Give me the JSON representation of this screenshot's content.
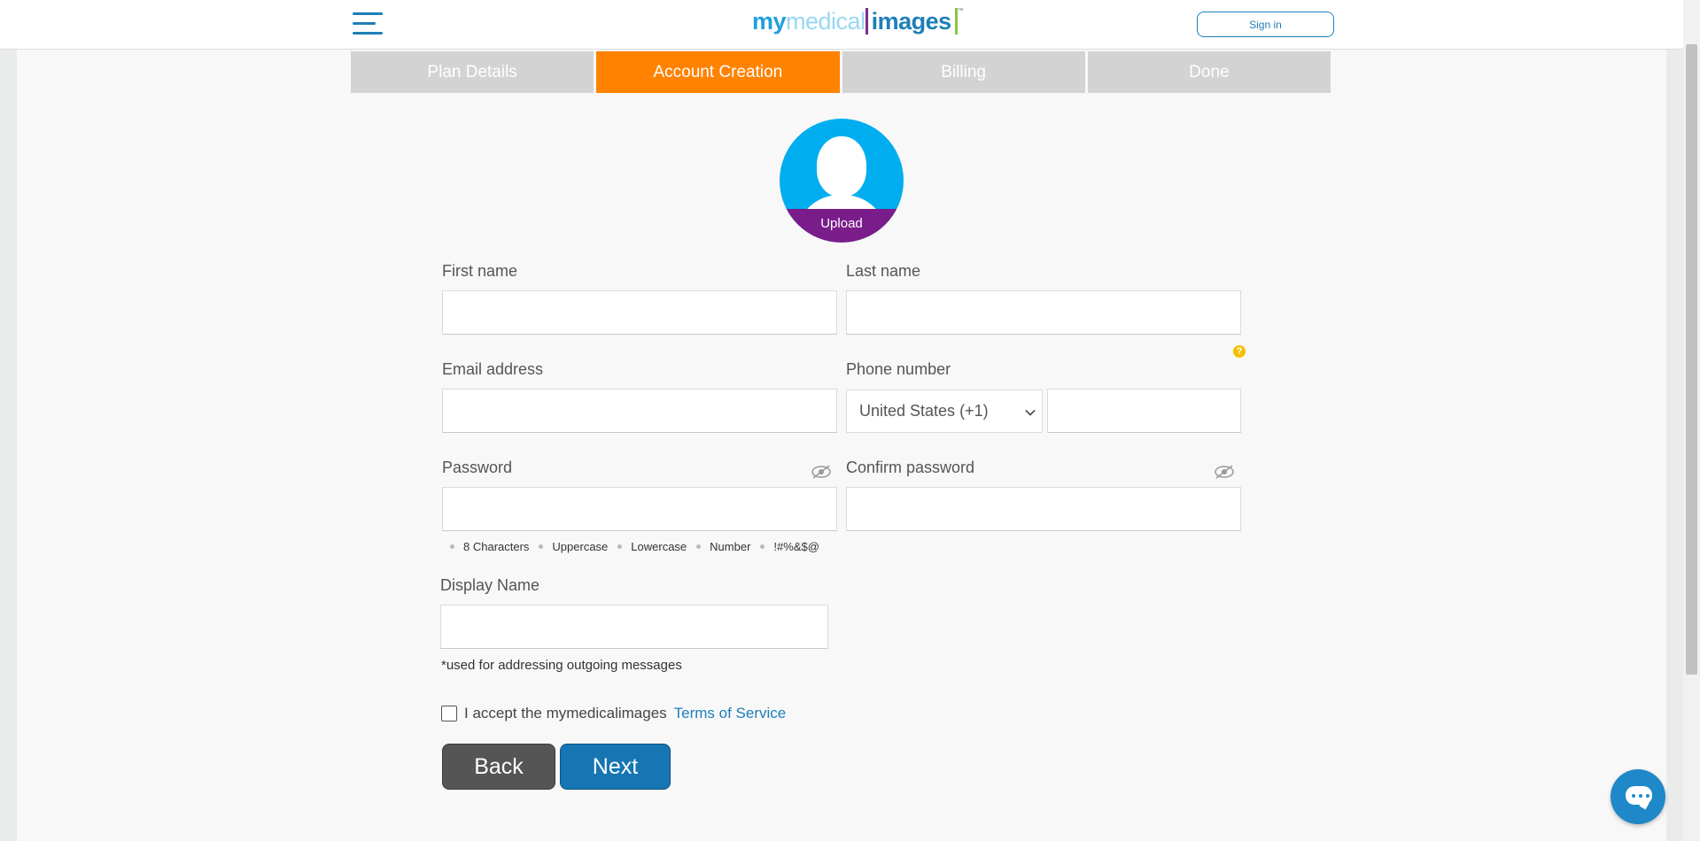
{
  "header": {
    "logo_part1": "my",
    "logo_part2": "medical",
    "logo_part3": "images",
    "menu_icon": "hamburger-menu-icon",
    "signin_label": "Sign in"
  },
  "steps": [
    {
      "label": "Plan Details",
      "active": false
    },
    {
      "label": "Account Creation",
      "active": true
    },
    {
      "label": "Billing",
      "active": false
    },
    {
      "label": "Done",
      "active": false
    }
  ],
  "avatar": {
    "upload_label": "Upload"
  },
  "form": {
    "first_name": {
      "label": "First name",
      "value": ""
    },
    "last_name": {
      "label": "Last name",
      "value": ""
    },
    "email": {
      "label": "Email address",
      "value": ""
    },
    "phone": {
      "label": "Phone number",
      "country": "United States (+1)",
      "value": ""
    },
    "password": {
      "label": "Password",
      "value": ""
    },
    "confirm_password": {
      "label": "Confirm password",
      "value": ""
    },
    "password_rules": [
      "8 Characters",
      "Uppercase",
      "Lowercase",
      "Number",
      "!#%&$@"
    ],
    "display_name": {
      "label": "Display Name",
      "value": "",
      "note": "*used for addressing outgoing messages"
    },
    "terms": {
      "text": "I accept the mymedicalimages",
      "link": "Terms of Service",
      "checked": false
    }
  },
  "buttons": {
    "back": "Back",
    "next": "Next"
  },
  "colors": {
    "accent": "#ff8200",
    "primary": "#1576b3",
    "brand_blue": "#20a0dc",
    "upload_purple": "#7a1d8a",
    "avatar_blue": "#00aeef"
  }
}
